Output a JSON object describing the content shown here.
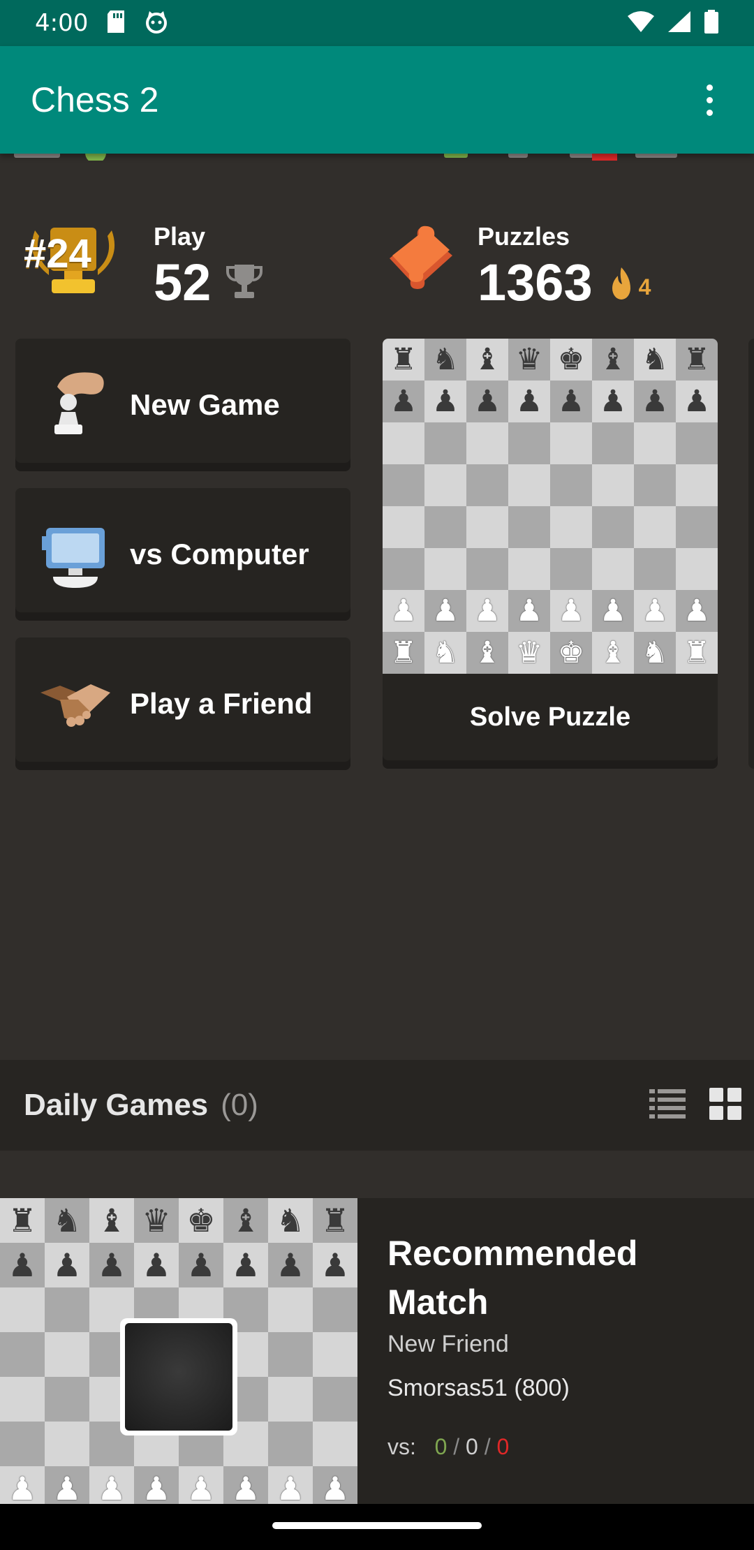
{
  "status_bar": {
    "time": "4:00"
  },
  "app_bar": {
    "title": "Chess 2"
  },
  "stats": {
    "play": {
      "rank_badge": "#24",
      "label": "Play",
      "rating": "52"
    },
    "puzzles": {
      "label": "Puzzles",
      "rating": "1363",
      "streak": "4"
    }
  },
  "menu": {
    "new_game": "New Game",
    "vs_computer": "vs Computer",
    "play_friend": "Play a Friend"
  },
  "puzzle_card": {
    "button_label": "Solve Puzzle"
  },
  "daily_games": {
    "title": "Daily Games",
    "count": "(0)"
  },
  "recommended": {
    "title": "Recommended Match",
    "subtitle": "New Friend",
    "player": "Smorsas51 (800)",
    "vs_label": "vs:",
    "wins": "0",
    "draws": "0",
    "losses": "0",
    "separator": "/"
  },
  "colors": {
    "status_bar": "#00695c",
    "app_bar": "#00897b",
    "background": "#312e2b",
    "card": "#262421",
    "streak_accent": "#e8a53c",
    "win_green": "#7fa650",
    "loss_red": "#e02828"
  },
  "icons": [
    "sd-card-icon",
    "cat-icon",
    "wifi-icon",
    "signal-icon",
    "battery-icon",
    "more-vert-icon",
    "trophy-icon",
    "flame-icon",
    "puzzle-icon",
    "pawn-hand-icon",
    "computer-icon",
    "handshake-icon",
    "list-view-icon",
    "grid-view-icon"
  ]
}
